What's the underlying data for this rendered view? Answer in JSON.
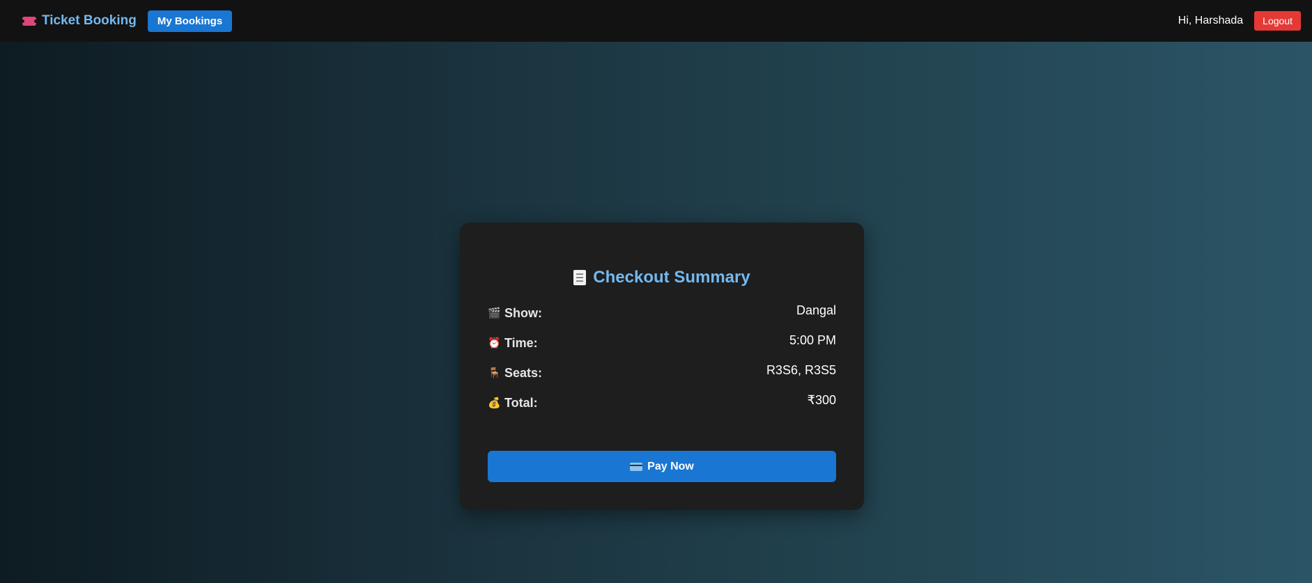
{
  "navbar": {
    "brand_icon": "ticket-icon",
    "brand_title": "Ticket Booking",
    "my_bookings_label": "My Bookings",
    "greeting": "Hi, Harshada",
    "logout_label": "Logout"
  },
  "checkout": {
    "title_icon": "receipt-icon",
    "title": "Checkout Summary",
    "rows": [
      {
        "icon": "clapperboard-icon",
        "glyph": "🎬",
        "label": "Show:",
        "value": "Dangal"
      },
      {
        "icon": "alarm-clock-icon",
        "glyph": "⏰",
        "label": "Time:",
        "value": "5:00 PM"
      },
      {
        "icon": "chair-icon",
        "glyph": "🪑",
        "label": "Seats:",
        "value": "R3S6, R3S5"
      },
      {
        "icon": "money-bag-icon",
        "glyph": "💰",
        "label": "Total:",
        "value": "₹300"
      }
    ],
    "pay_icon": "credit-card-icon",
    "pay_label": "Pay Now"
  },
  "colors": {
    "accent": "#1976d2",
    "title": "#74b9f0",
    "logout": "#e53935",
    "card_bg": "#1e1e1e",
    "navbar_bg": "#121212"
  }
}
